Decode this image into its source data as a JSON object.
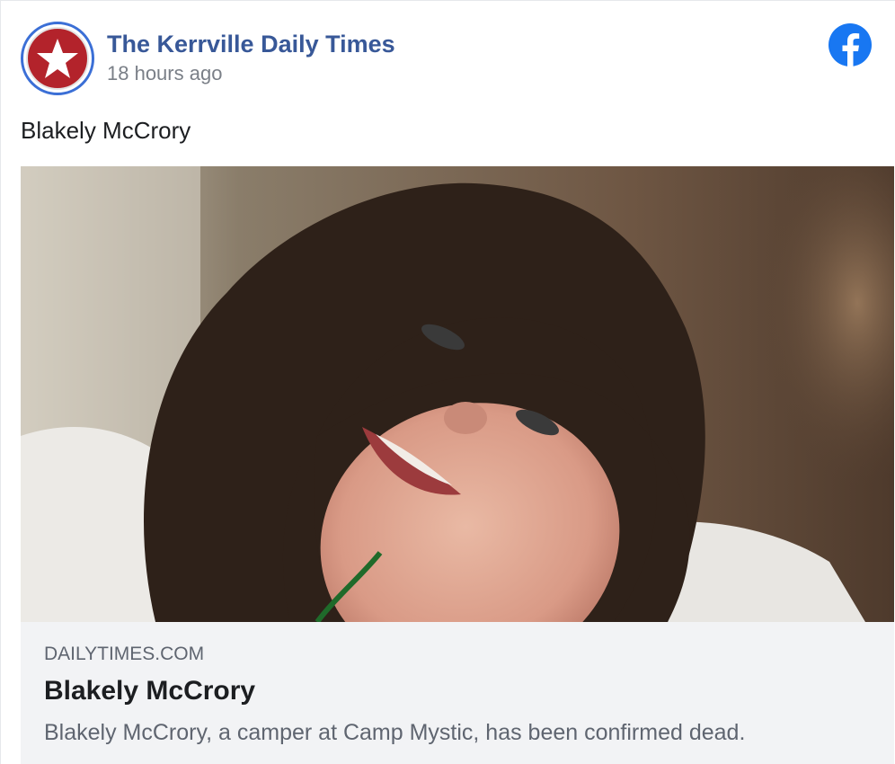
{
  "post": {
    "page_name": "The Kerrville Daily Times",
    "timestamp": "18 hours ago",
    "text": "Blakely McCrory",
    "avatar_icon": "star-logo-icon",
    "platform_icon": "facebook-icon"
  },
  "link_preview": {
    "domain": "DAILYTIMES.COM",
    "title": "Blakely McCrory",
    "description": "Blakely McCrory, a camper at Camp Mystic, has been confirmed dead.",
    "image_subject": "Photo of a smiling girl with long dark hair"
  },
  "colors": {
    "page_name": "#385898",
    "facebook_blue": "#1877f2",
    "avatar_red": "#b3232b",
    "card_background": "#f2f3f5"
  }
}
